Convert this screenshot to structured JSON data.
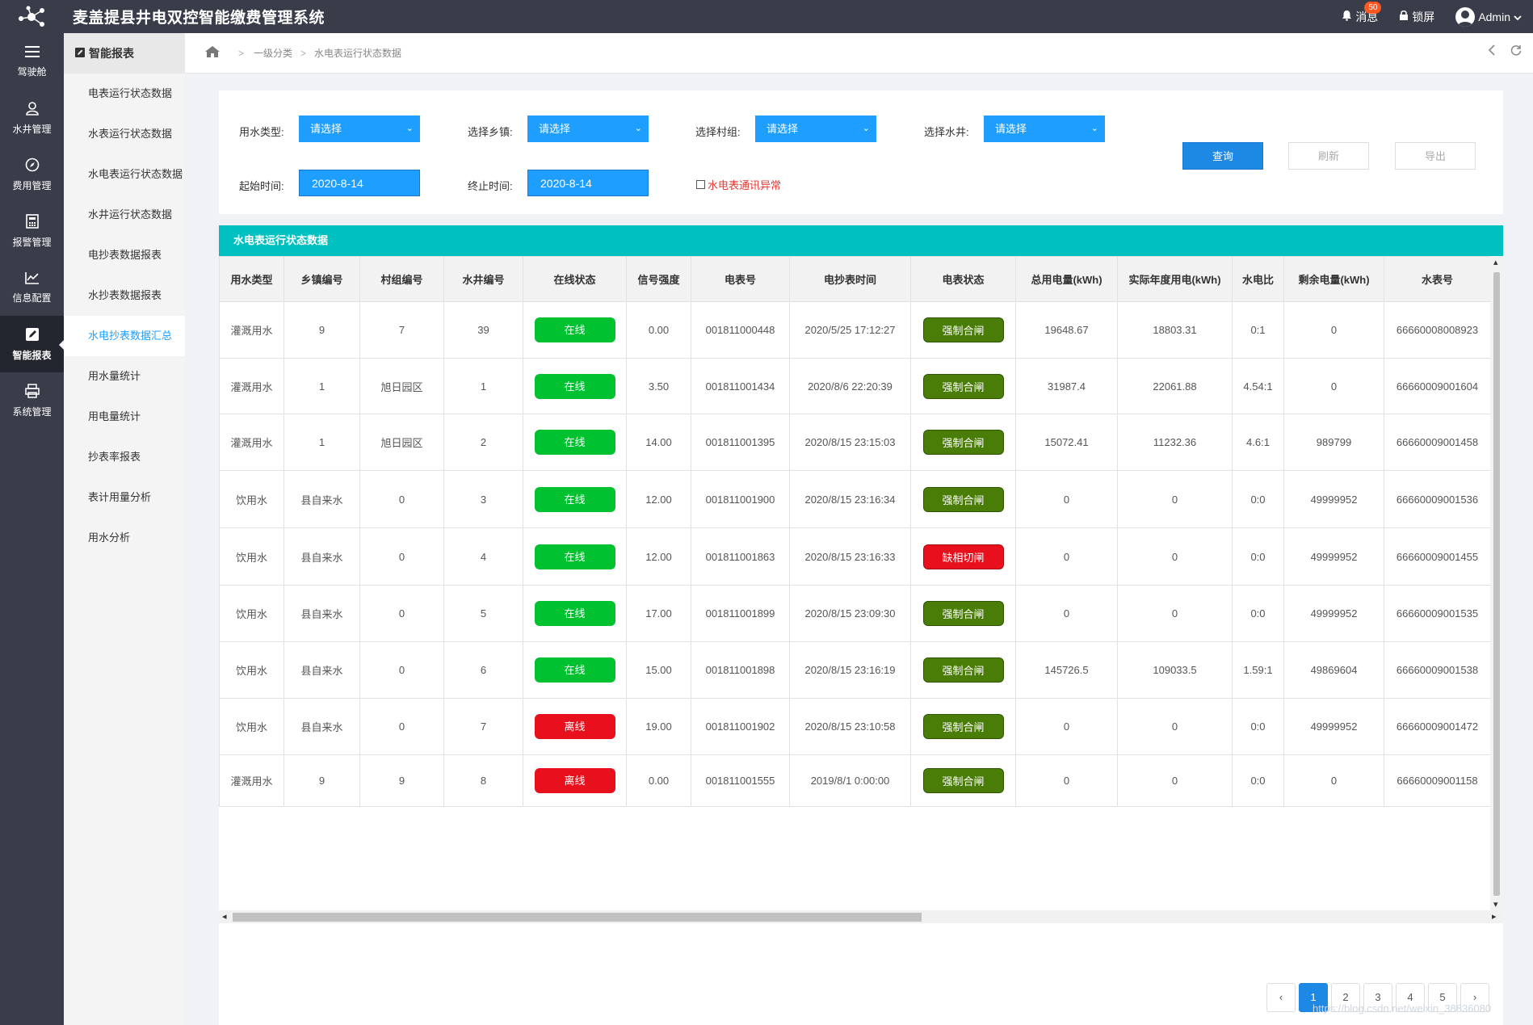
{
  "header": {
    "title": "麦盖提县井电双控智能缴费管理系统",
    "messages_label": "消息",
    "messages_badge": "50",
    "lock_label": "锁屏",
    "user_label": "Admin"
  },
  "mainnav": [
    {
      "label": "驾驶舱",
      "icon": "menu-icon"
    },
    {
      "label": "水井管理",
      "icon": "user-icon"
    },
    {
      "label": "费用管理",
      "icon": "compass-icon"
    },
    {
      "label": "报警管理",
      "icon": "calculator-icon"
    },
    {
      "label": "信息配置",
      "icon": "chart-icon"
    },
    {
      "label": "智能报表",
      "icon": "edit-icon"
    },
    {
      "label": "系统管理",
      "icon": "print-icon"
    }
  ],
  "subnav": {
    "title": "智能报表",
    "items": [
      "电表运行状态数据",
      "水表运行状态数据",
      "水电表运行状态数据",
      "水井运行状态数据",
      "电抄表数据报表",
      "水抄表数据报表",
      "水电抄表数据汇总",
      "用水量统计",
      "用电量统计",
      "抄表率报表",
      "表计用量分析",
      "用水分析"
    ]
  },
  "breadcrumb": {
    "level1": "一级分类",
    "level2": "水电表运行状态数据"
  },
  "filters": {
    "water_type_label": "用水类型:",
    "town_label": "选择乡镇:",
    "village_label": "选择村组:",
    "well_label": "选择水井:",
    "select_placeholder": "请选择",
    "start_label": "起始时间:",
    "end_label": "终止时间:",
    "start_value": "2020-8-14",
    "end_value": "2020-8-14",
    "abnormal_label": "水电表通讯异常",
    "query_button": "查询",
    "refresh_button": "刷新",
    "export_button": "导出"
  },
  "table": {
    "title": "水电表运行状态数据",
    "columns": [
      "用水类型",
      "乡镇编号",
      "村组编号",
      "水井编号",
      "在线状态",
      "信号强度",
      "电表号",
      "电抄表时间",
      "电表状态",
      "总用电量(kWh)",
      "实际年度用电(kWh)",
      "水电比",
      "剩余电量(kWh)",
      "水表号"
    ],
    "rows": [
      [
        "灌溉用水",
        "9",
        "7",
        "39",
        "在线",
        "0.00",
        "001811000448",
        "2020/5/25 17:12:27",
        "强制合闸",
        "19648.67",
        "18803.31",
        "0:1",
        "0",
        "66660008008923"
      ],
      [
        "灌溉用水",
        "1",
        "旭日园区",
        "1",
        "在线",
        "3.50",
        "001811001434",
        "2020/8/6 22:20:39",
        "强制合闸",
        "31987.4",
        "22061.88",
        "4.54:1",
        "0",
        "66660009001604"
      ],
      [
        "灌溉用水",
        "1",
        "旭日园区",
        "2",
        "在线",
        "14.00",
        "001811001395",
        "2020/8/15 23:15:03",
        "强制合闸",
        "15072.41",
        "11232.36",
        "4.6:1",
        "989799",
        "66660009001458"
      ],
      [
        "饮用水",
        "县自来水",
        "0",
        "3",
        "在线",
        "12.00",
        "001811001900",
        "2020/8/15 23:16:34",
        "强制合闸",
        "0",
        "0",
        "0:0",
        "49999952",
        "66660009001536"
      ],
      [
        "饮用水",
        "县自来水",
        "0",
        "4",
        "在线",
        "12.00",
        "001811001863",
        "2020/8/15 23:16:33",
        "缺相切闸",
        "0",
        "0",
        "0:0",
        "49999952",
        "66660009001455"
      ],
      [
        "饮用水",
        "县自来水",
        "0",
        "5",
        "在线",
        "17.00",
        "001811001899",
        "2020/8/15 23:09:30",
        "强制合闸",
        "0",
        "0",
        "0:0",
        "49999952",
        "66660009001535"
      ],
      [
        "饮用水",
        "县自来水",
        "0",
        "6",
        "在线",
        "15.00",
        "001811001898",
        "2020/8/15 23:16:19",
        "强制合闸",
        "145726.5",
        "109033.5",
        "1.59:1",
        "49869604",
        "66660009001538"
      ],
      [
        "饮用水",
        "县自来水",
        "0",
        "7",
        "离线",
        "19.00",
        "001811001902",
        "2020/8/15 23:10:58",
        "强制合闸",
        "0",
        "0",
        "0:0",
        "49999952",
        "66660009001472"
      ],
      [
        "灌溉用水",
        "9",
        "9",
        "8",
        "离线",
        "0.00",
        "001811001555",
        "2019/8/1 0:00:00",
        "强制合闸",
        "0",
        "0",
        "0:0",
        "0",
        "66660009001158"
      ]
    ]
  },
  "pagination": {
    "prev": "‹",
    "next": "›",
    "pages": [
      "1",
      "2",
      "3",
      "4",
      "5"
    ],
    "current": "1"
  },
  "watermark": "https://blog.csdn.net/weixin_38836080",
  "colors": {
    "header_bg": "#393d49",
    "accent": "#1e9fff",
    "table_title_bg": "#00c0c0",
    "online": "#00c230",
    "offline": "#e8101c",
    "forced_close": "#4a7d08"
  }
}
